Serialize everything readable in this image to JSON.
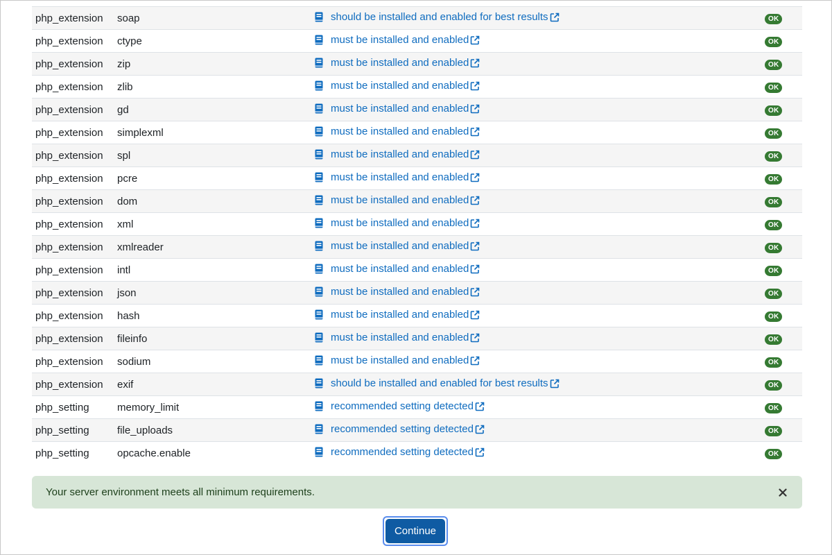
{
  "rows": [
    {
      "type": "php_extension",
      "name": "soap",
      "report": "should be installed and enabled for best results",
      "status": "OK"
    },
    {
      "type": "php_extension",
      "name": "ctype",
      "report": "must be installed and enabled",
      "status": "OK"
    },
    {
      "type": "php_extension",
      "name": "zip",
      "report": "must be installed and enabled",
      "status": "OK"
    },
    {
      "type": "php_extension",
      "name": "zlib",
      "report": "must be installed and enabled",
      "status": "OK"
    },
    {
      "type": "php_extension",
      "name": "gd",
      "report": "must be installed and enabled",
      "status": "OK"
    },
    {
      "type": "php_extension",
      "name": "simplexml",
      "report": "must be installed and enabled",
      "status": "OK"
    },
    {
      "type": "php_extension",
      "name": "spl",
      "report": "must be installed and enabled",
      "status": "OK"
    },
    {
      "type": "php_extension",
      "name": "pcre",
      "report": "must be installed and enabled",
      "status": "OK"
    },
    {
      "type": "php_extension",
      "name": "dom",
      "report": "must be installed and enabled",
      "status": "OK"
    },
    {
      "type": "php_extension",
      "name": "xml",
      "report": "must be installed and enabled",
      "status": "OK"
    },
    {
      "type": "php_extension",
      "name": "xmlreader",
      "report": "must be installed and enabled",
      "status": "OK"
    },
    {
      "type": "php_extension",
      "name": "intl",
      "report": "must be installed and enabled",
      "status": "OK"
    },
    {
      "type": "php_extension",
      "name": "json",
      "report": "must be installed and enabled",
      "status": "OK"
    },
    {
      "type": "php_extension",
      "name": "hash",
      "report": "must be installed and enabled",
      "status": "OK"
    },
    {
      "type": "php_extension",
      "name": "fileinfo",
      "report": "must be installed and enabled",
      "status": "OK"
    },
    {
      "type": "php_extension",
      "name": "sodium",
      "report": "must be installed and enabled",
      "status": "OK"
    },
    {
      "type": "php_extension",
      "name": "exif",
      "report": "should be installed and enabled for best results",
      "status": "OK"
    },
    {
      "type": "php_setting",
      "name": "memory_limit",
      "report": "recommended setting detected",
      "status": "OK"
    },
    {
      "type": "php_setting",
      "name": "file_uploads",
      "report": "recommended setting detected",
      "status": "OK"
    },
    {
      "type": "php_setting",
      "name": "opcache.enable",
      "report": "recommended setting detected",
      "status": "OK"
    }
  ],
  "icons": {
    "report_doc": "book-icon",
    "report_external": "external-link-icon",
    "alert_close": "close-icon"
  },
  "colors": {
    "link": "#0f6cbf",
    "ok_badge": "#357a32",
    "alert_bg": "#d7e6d7",
    "button": "#0f5ba3"
  },
  "alert": {
    "message": "Your server environment meets all minimum requirements."
  },
  "actions": {
    "continue_label": "Continue"
  }
}
